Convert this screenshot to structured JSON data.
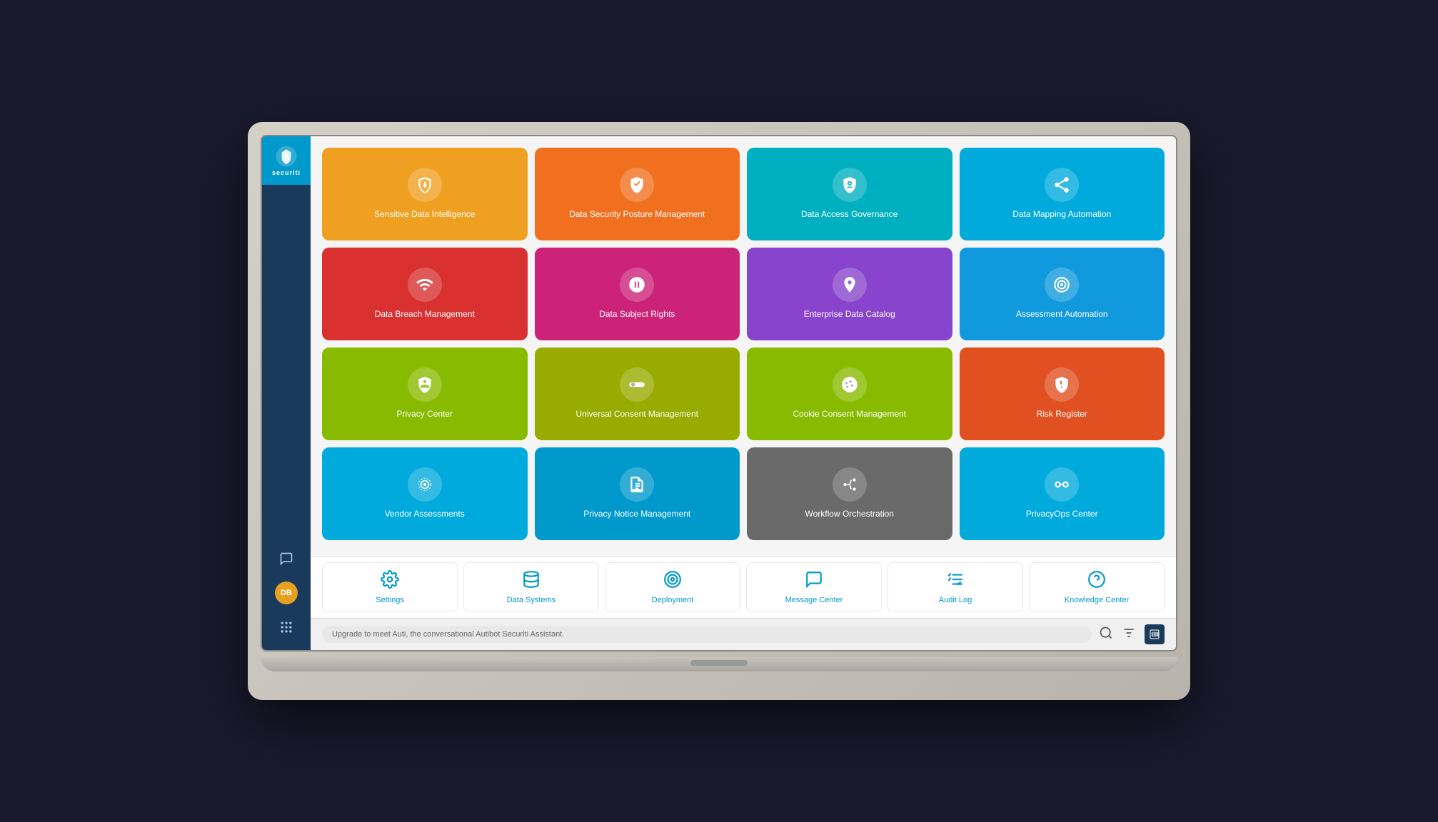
{
  "app": {
    "name": "securiti",
    "logo_text": "securiti"
  },
  "sidebar": {
    "bottom_icons": [
      {
        "name": "chat-icon",
        "symbol": "💬",
        "label": "Chat"
      },
      {
        "name": "user-avatar",
        "symbol": "DB",
        "label": "User"
      },
      {
        "name": "grid-icon",
        "symbol": "⠿",
        "label": "Grid"
      }
    ]
  },
  "tiles": [
    [
      {
        "id": "sensitive-data",
        "label": "Sensitive Data\nIntelligence",
        "color": "#f0a020",
        "icon": "shield-data"
      },
      {
        "id": "data-security-posture",
        "label": "Data Security Posture\nManagement",
        "color": "#f07020",
        "icon": "shield-check"
      },
      {
        "id": "data-access-governance",
        "label": "Data Access\nGovernance",
        "color": "#00b8c8",
        "icon": "shield-lock"
      },
      {
        "id": "data-mapping",
        "label": "Data Mapping\nAutomation",
        "color": "#00aadd",
        "icon": "share-nodes"
      }
    ],
    [
      {
        "id": "data-breach",
        "label": "Data Breach\nManagement",
        "color": "#e03030",
        "icon": "wifi-breach"
      },
      {
        "id": "data-subject-rights",
        "label": "Data Subject Rights",
        "color": "#d03080",
        "icon": "subject-rights"
      },
      {
        "id": "enterprise-data-catalog",
        "label": "Enterprise Data\nCatalog",
        "color": "#8844cc",
        "icon": "catalog"
      },
      {
        "id": "assessment-automation",
        "label": "Assessment Automation",
        "color": "#1199dd",
        "icon": "assessment"
      }
    ],
    [
      {
        "id": "privacy-center",
        "label": "Privacy Center",
        "color": "#88bb00",
        "icon": "privacy"
      },
      {
        "id": "universal-consent",
        "label": "Universal Consent\nManagement",
        "color": "#99aa00",
        "icon": "consent"
      },
      {
        "id": "cookie-consent",
        "label": "Cookie Consent\nManagement",
        "color": "#88bb00",
        "icon": "cookie"
      },
      {
        "id": "risk-register",
        "label": "Risk Register",
        "color": "#e05020",
        "icon": "risk"
      }
    ],
    [
      {
        "id": "vendor-assessments",
        "label": "Vendor Assessments",
        "color": "#00aadd",
        "icon": "vendor"
      },
      {
        "id": "privacy-notice",
        "label": "Privacy Notice\nManagement",
        "color": "#0099cc",
        "icon": "notice"
      },
      {
        "id": "workflow-orchestration",
        "label": "Workflow Orchestration",
        "color": "#707070",
        "icon": "workflow"
      },
      {
        "id": "privacyops-center",
        "label": "PrivacyOps Center",
        "color": "#00aadd",
        "icon": "privacyops"
      }
    ]
  ],
  "bottom_items": [
    {
      "id": "settings",
      "label": "Settings",
      "icon": "gear"
    },
    {
      "id": "data-systems",
      "label": "Data Systems",
      "icon": "database"
    },
    {
      "id": "deployment",
      "label": "Deployment",
      "icon": "deploy"
    },
    {
      "id": "message-center",
      "label": "Message Center",
      "icon": "message"
    },
    {
      "id": "audit-log",
      "label": "Audit Log",
      "icon": "audit"
    },
    {
      "id": "knowledge-center",
      "label": "Knowledge Center",
      "icon": "help"
    }
  ],
  "footer": {
    "chat_placeholder": "Upgrade to meet Auti, the conversational Autibot Securiti Assistant."
  }
}
